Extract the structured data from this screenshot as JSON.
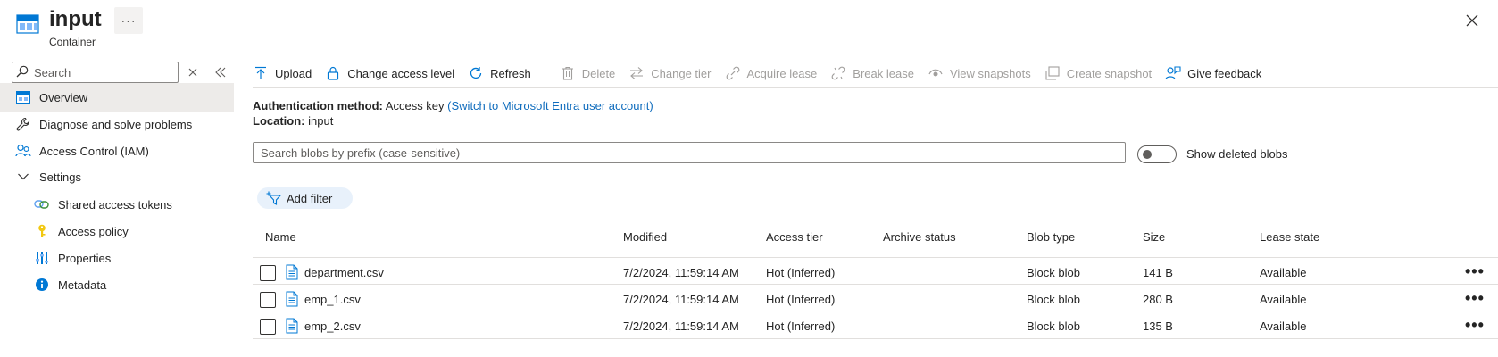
{
  "header": {
    "title": "input",
    "subtitle": "Container",
    "more": "···"
  },
  "sidebar": {
    "search_placeholder": "Search",
    "items": [
      {
        "label": "Overview",
        "icon": "overview-icon"
      },
      {
        "label": "Diagnose and solve problems",
        "icon": "wrench-icon"
      },
      {
        "label": "Access Control (IAM)",
        "icon": "people-icon"
      },
      {
        "label": "Settings",
        "icon": "chevron-down-icon"
      },
      {
        "label": "Shared access tokens",
        "icon": "link-icon"
      },
      {
        "label": "Access policy",
        "icon": "key-icon"
      },
      {
        "label": "Properties",
        "icon": "properties-icon"
      },
      {
        "label": "Metadata",
        "icon": "info-icon"
      }
    ]
  },
  "toolbar": {
    "upload": "Upload",
    "change_access_level": "Change access level",
    "refresh": "Refresh",
    "delete": "Delete",
    "change_tier": "Change tier",
    "acquire_lease": "Acquire lease",
    "break_lease": "Break lease",
    "view_snapshots": "View snapshots",
    "create_snapshot": "Create snapshot",
    "give_feedback": "Give feedback"
  },
  "info": {
    "auth_label": "Authentication method:",
    "auth_value": "Access key",
    "auth_link": "(Switch to Microsoft Entra user account)",
    "location_label": "Location:",
    "location_value": "input"
  },
  "blob_search": {
    "placeholder": "Search blobs by prefix (case-sensitive)"
  },
  "toggle": {
    "label": "Show deleted blobs"
  },
  "filter": {
    "add_label": "Add filter"
  },
  "table": {
    "columns": [
      "Name",
      "Modified",
      "Access tier",
      "Archive status",
      "Blob type",
      "Size",
      "Lease state"
    ],
    "rows": [
      {
        "name": "department.csv",
        "modified": "7/2/2024, 11:59:14 AM",
        "tier": "Hot (Inferred)",
        "archive": "",
        "type": "Block blob",
        "size": "141 B",
        "lease": "Available",
        "more": "•••"
      },
      {
        "name": "emp_1.csv",
        "modified": "7/2/2024, 11:59:14 AM",
        "tier": "Hot (Inferred)",
        "archive": "",
        "type": "Block blob",
        "size": "280 B",
        "lease": "Available",
        "more": "•••"
      },
      {
        "name": "emp_2.csv",
        "modified": "7/2/2024, 11:59:14 AM",
        "tier": "Hot (Inferred)",
        "archive": "",
        "type": "Block blob",
        "size": "135 B",
        "lease": "Available",
        "more": "•••"
      }
    ]
  },
  "colors": {
    "accent": "#0f6cbd",
    "active_nav": "#edebe9",
    "disabled": "#a19f9d"
  }
}
